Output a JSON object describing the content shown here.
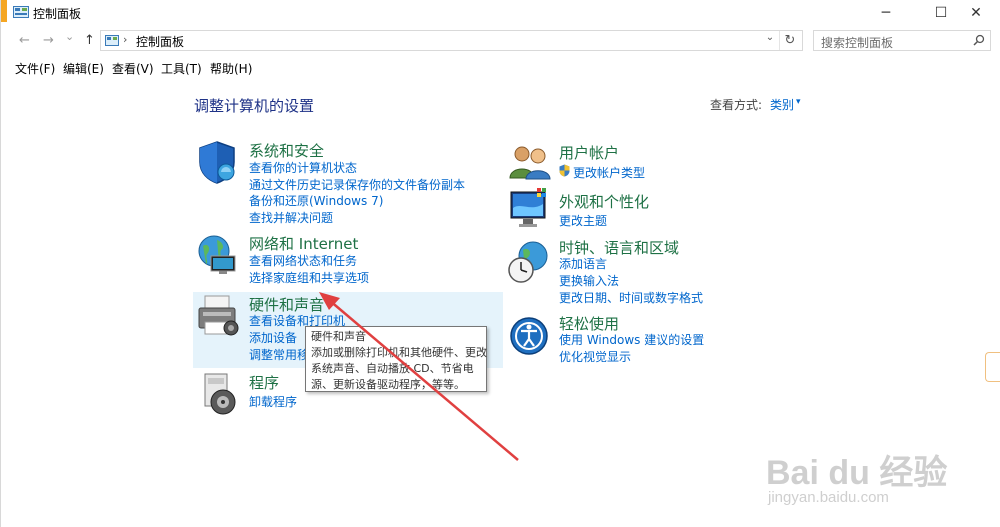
{
  "window": {
    "title": "控制面板",
    "minimize": "─",
    "maximize": "☐",
    "close": "✕"
  },
  "nav": {
    "back": "←",
    "forward": "→",
    "recent": "⌄",
    "up": "↑",
    "breadcrumb_sep": "›",
    "address": "控制面板",
    "dropdown": "⌄",
    "refresh": "↻",
    "search_placeholder": "搜索控制面板"
  },
  "menu": [
    "文件(F)",
    "编辑(E)",
    "查看(V)",
    "工具(T)",
    "帮助(H)"
  ],
  "main": {
    "heading": "调整计算机的设置",
    "view_by_label": "查看方式:",
    "view_by_value": "类别",
    "view_by_caret": "▾"
  },
  "categories": {
    "system": {
      "title": "系统和安全",
      "links": [
        "查看你的计算机状态",
        "通过文件历史记录保存你的文件备份副本",
        "备份和还原(Windows 7)",
        "查找并解决问题"
      ]
    },
    "network": {
      "title": "网络和 Internet",
      "links": [
        "查看网络状态和任务",
        "选择家庭组和共享选项"
      ]
    },
    "hardware": {
      "title": "硬件和声音",
      "links": [
        "查看设备和打印机",
        "添加设备",
        "调整常用移动设置"
      ]
    },
    "programs": {
      "title": "程序",
      "links": [
        "卸载程序"
      ]
    },
    "users": {
      "title": "用户帐户",
      "links": [
        "更改帐户类型"
      ]
    },
    "appearance": {
      "title": "外观和个性化",
      "links": [
        "更改主题"
      ]
    },
    "clock": {
      "title": "时钟、语言和区域",
      "links": [
        "添加语言",
        "更换输入法",
        "更改日期、时间或数字格式"
      ]
    },
    "ease": {
      "title": "轻松使用",
      "links": [
        "使用 Windows 建议的设置",
        "优化视觉显示"
      ]
    }
  },
  "tooltip": {
    "lines": [
      "硬件和声音",
      "添加或删除打印机和其他硬件、更改",
      "系统声音、自动播放 CD、节省电",
      "源、更新设备驱动程序，等等。"
    ]
  },
  "watermark": {
    "brand": "Bai du 经验",
    "url": "jingyan.baidu.com"
  },
  "colors": {
    "category_title": "#1e7145",
    "link": "#0066cc",
    "heading": "#1e3287",
    "hover_highlight": "#e5f3fb",
    "arrow": "#e04040"
  }
}
